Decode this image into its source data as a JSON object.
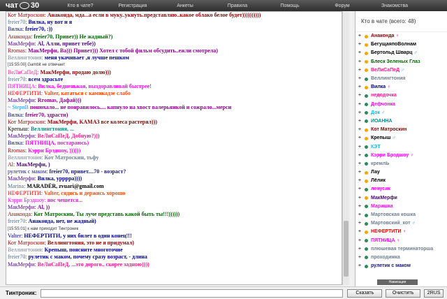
{
  "header": {
    "logo_text": "чат",
    "logo_number": "30",
    "nav": [
      "Кто в чате?",
      "Регистрация",
      "Анкеты",
      "Правила",
      "Помощь",
      "Форум",
      "Знакомства"
    ]
  },
  "messages": [
    {
      "nick": "Кот Матроскин:",
      "nc": "#8b0000",
      "body": "Анаконда, мда...а если в муку..укнуть.представляю..какое облако белое будет))))))))))",
      "bc": "#8b0000"
    },
    {
      "nick": "freier70:",
      "nc": "#4a6b8a",
      "body": "Вилка, ну вот и я",
      "bc": "#00008b"
    },
    {
      "nick": "Вилка:",
      "nc": "#00008b",
      "body": "freier70, :))",
      "bc": "#00008b"
    },
    {
      "nick": "Анаконда:",
      "nc": "#8b0000",
      "body": "freier70, Привет)) Не жадный?)",
      "bc": "#006400"
    },
    {
      "nick": "МакМерфи:",
      "nc": "#4b0082",
      "body": "Al, Алли, привет тебе))",
      "bc": "#4b0082"
    },
    {
      "nick": "Rromas:",
      "nc": "#8b0000",
      "body": "МакМерфи, Ва))) Привет))) Хотел с тобой фильм обсудить..ежли смотрела)",
      "bc": "#8b008b"
    },
    {
      "nick": "Веллингтония:",
      "nc": "#708090",
      "body": "меня укачивает ,я лучше пешком",
      "bc": "#00008b"
    },
    {
      "sys": "[15:55:00] Gambit не отвечает"
    },
    {
      "nick": "ВеЛиСаПеД:",
      "nc": "#ff1493",
      "body": "МакМерфи, продаю долю)))",
      "bc": "#8b0000"
    },
    {
      "nick": "freier70:",
      "nc": "#4a6b8a",
      "body": "всем здрасьте",
      "bc": "#00008b"
    },
    {
      "nick": "ПЯТНИЦА:",
      "nc": "#ff00ff",
      "body": "Вилка, бедненькая, выздоравливай быстрее!",
      "bc": "#ff00ff"
    },
    {
      "nick": "НЕФЕРТИТИ:",
      "nc": "#ff0000",
      "body": "Valter, кататься с камикадзе слабо",
      "bc": "#ff4500"
    },
    {
      "nick": "МакМерфи:",
      "nc": "#4b0082",
      "body": "Rromas, Дафай)))",
      "bc": "#8b008b"
    },
    {
      "nick": "~ StepnВ",
      "nc": "#1e90ff",
      "body": "понюхало... не понравилось.... капнуло на хвост валерьянкой и сожрало...мерси",
      "bc": "#8b008b"
    },
    {
      "nick": "Вилка:",
      "nc": "#00008b",
      "body": "freier70, здрасти)",
      "bc": "#8b008b"
    },
    {
      "nick": "Кот Матроскин:",
      "nc": "#8b0000",
      "body": "МакМерфи, КАМАЗ все колеса растерял)))",
      "bc": "#8b0000"
    },
    {
      "nick": "Крепыш:",
      "nc": "#000000",
      "body": "Веллингтония, ...",
      "bc": "#008b8b"
    },
    {
      "nick": "МакМерфи:",
      "nc": "#4b0082",
      "body": "ВеЛиСаПеД, Добную?)))",
      "bc": "#ff1493"
    },
    {
      "nick": "Вилка:",
      "nc": "#00008b",
      "body": "ПЯТНИЦА, постараюсь)",
      "bc": "#ff00ff"
    },
    {
      "nick": "Rromas:",
      "nc": "#8b0000",
      "body": "Кэрри Брэдшоу, ))))))",
      "bc": "#ff00ff"
    },
    {
      "nick": "Веллингтония:",
      "nc": "#708090",
      "body": "Кот Матроскин, тьфу",
      "bc": "#708090"
    },
    {
      "nick": "Al:",
      "nc": "#8b0000",
      "body": "МакМерфи, )",
      "bc": "#4b0082"
    },
    {
      "nick": "рулетик с маком:",
      "nc": "#191970",
      "body": "freier70, привет....70 - возраст?",
      "bc": "#191970"
    },
    {
      "nick": "МакМерфи:",
      "nc": "#4b0082",
      "body": "Вилка, урррра))))",
      "bc": "#00008b"
    },
    {
      "nick": "Marina:",
      "nc": "#4a6b8a",
      "body": "MARADÉR, zvuari@gmail.com",
      "bc": "#000000"
    },
    {
      "nick": "НЕФЕРТИТИ:",
      "nc": "#ff0000",
      "body": "Valter, сядись и держись хорошо",
      "bc": "#ff4500"
    },
    {
      "nick": "Кэрри Брэдшоу:",
      "nc": "#ff00ff",
      "body": "нос чешется...",
      "bc": "#ff00ff"
    },
    {
      "nick": "МакМерфи:",
      "nc": "#4b0082",
      "body": "Al, ))",
      "bc": "#8b008b"
    },
    {
      "nick": "Анаконда:",
      "nc": "#8b0000",
      "body": "Кот Матроскин, Ты луче представь какой быть ты!!!))))))",
      "bc": "#006400"
    },
    {
      "nick": "freier70:",
      "nc": "#4a6b8a",
      "body": "Анаконда, нет, не жадный)",
      "bc": "#00008b"
    },
    {
      "sys": "[15:55:01] к нам приходит Тинтроник"
    },
    {
      "nick": "Valter:",
      "nc": "#00008b",
      "body": "НЕФЕРТИТИ, у них билет в один конец!!!",
      "bc": "#00008b"
    },
    {
      "nick": "Кот Матроскин:",
      "nc": "#8b0000",
      "body": "Веллингтония, это не я придумал)",
      "bc": "#8b0000"
    },
    {
      "nick": "Веллингтония:",
      "nc": "#708090",
      "body": "Крепыш, поясните многоточие",
      "bc": "#00008b"
    },
    {
      "nick": "freier70:",
      "nc": "#4a6b8a",
      "body": "рулетик с маком, почему сразу возраст, - длина",
      "bc": "#00008b"
    },
    {
      "nick": "МакМерфи:",
      "nc": "#4b0082",
      "body": "ВеЛиСаПеД, ...это дорого.. скорее задною))))",
      "bc": "#ff1493"
    }
  ],
  "sidebar": {
    "title": "Кто в чате (всего: 48)",
    "users": [
      {
        "name": "Анаконда",
        "c": "#8b0000",
        "d": "#ffa500",
        "g": "♀"
      },
      {
        "name": "БегущаяпоВолнам",
        "c": "#000000",
        "d": "#ffa500",
        "g": ""
      },
      {
        "name": "Бертольд Шварц",
        "c": "#000000",
        "d": "#ffa500",
        "g": "♂"
      },
      {
        "name": "Блеск Зеленых Глаз",
        "c": "#006400",
        "d": "#ffa500",
        "g": ""
      },
      {
        "name": "ВеЛиСаПеД",
        "c": "#ff1493",
        "d": "#ffa500",
        "g": "♂"
      },
      {
        "name": "Веллингтония",
        "c": "#708090",
        "d": "#2e8b57",
        "g": ""
      },
      {
        "name": "Вилка",
        "c": "#00008b",
        "d": "#ffa500",
        "g": "♀"
      },
      {
        "name": "недодочка",
        "c": "#ff1493",
        "d": "#2e8b57",
        "g": ""
      },
      {
        "name": "Дефчонка",
        "c": "#ff00ff",
        "d": "#2e8b57",
        "g": ""
      },
      {
        "name": "Док",
        "c": "#00bfff",
        "d": "#2e8b57",
        "g": "♂"
      },
      {
        "name": "ИОАННА",
        "c": "#008b8b",
        "d": "#2e8b57",
        "g": ""
      },
      {
        "name": "Кот Матроскин",
        "c": "#8b0000",
        "d": "#ffa500",
        "g": ""
      },
      {
        "name": "Крепыш",
        "c": "#000000",
        "d": "#ffa500",
        "g": "♂"
      },
      {
        "name": "КЭТ",
        "c": "#00bfff",
        "d": "#2e8b57",
        "g": ""
      },
      {
        "name": "Кэрри Брэдшоу",
        "c": "#ff00ff",
        "d": "#2e8b57",
        "g": "♀"
      },
      {
        "name": "кремлЬ",
        "c": "#708090",
        "d": "#2e8b57",
        "g": ""
      },
      {
        "name": "Лау",
        "c": "#000000",
        "d": "#ffa500",
        "g": ""
      },
      {
        "name": "Лёлик",
        "c": "#000000",
        "d": "#ffa500",
        "g": ""
      },
      {
        "name": "ленусик",
        "c": "#ff00ff",
        "d": "#2e8b57",
        "g": ""
      },
      {
        "name": "МакМерфи",
        "c": "#4b0082",
        "d": "#ffa500",
        "g": ""
      },
      {
        "name": "Маришка",
        "c": "#ff00ff",
        "d": "#2e8b57",
        "g": ""
      },
      {
        "name": "Мартовская кошка",
        "c": "#708090",
        "d": "#2e8b57",
        "g": ""
      },
      {
        "name": "Мартовский_кот",
        "c": "#708090",
        "d": "#2e8b57",
        "g": "♂"
      },
      {
        "name": "НЕФЕРТИТИ",
        "c": "#ff0000",
        "d": "#ffa500",
        "g": "♀"
      },
      {
        "name": "ПЯТНИЦА",
        "c": "#ff00ff",
        "d": "#2e8b57",
        "g": "♀"
      },
      {
        "name": "плюшевая терминаторша",
        "c": "#708090",
        "d": "#2e8b57",
        "g": ""
      },
      {
        "name": "проходимка",
        "c": "#708090",
        "d": "#2e8b57",
        "g": ""
      },
      {
        "name": "рулетик с маком",
        "c": "#191970",
        "d": "#2e8b57",
        "g": ""
      }
    ]
  },
  "nav_button": "Навигация",
  "bottom": {
    "nick_label": "Тинтроник:",
    "input_value": "",
    "btn_say": "Сказать",
    "btn_clear": "Очистить",
    "btn_2rus": "2RUS"
  }
}
